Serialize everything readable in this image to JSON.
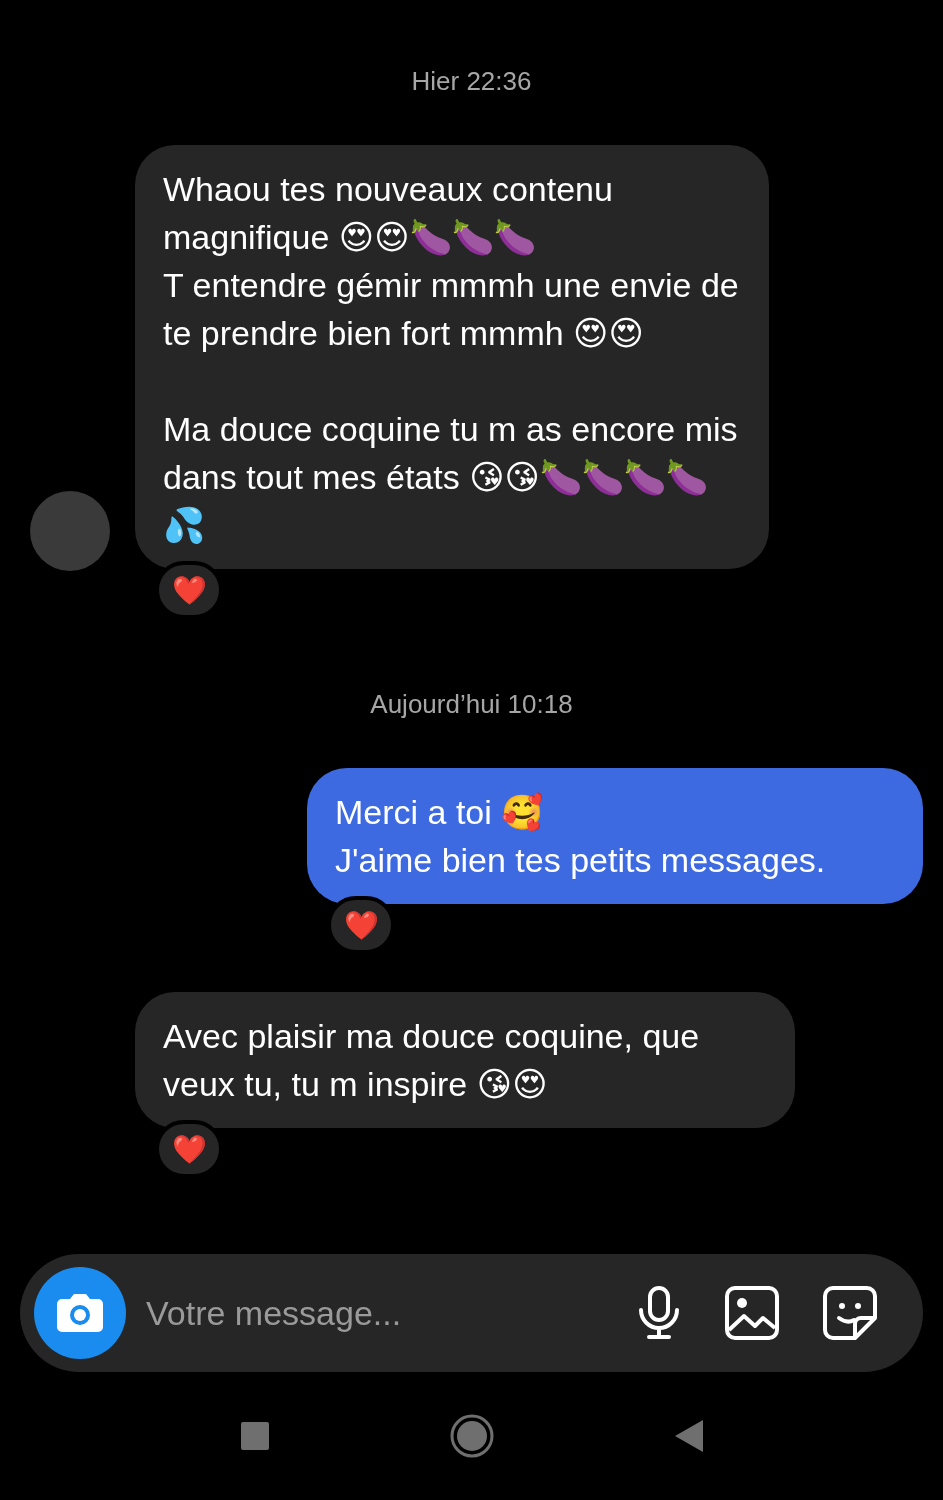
{
  "conversation": [
    {
      "kind": "timestamp",
      "text": "Hier 22:36"
    },
    {
      "kind": "incoming_message",
      "avatar": true,
      "text": "Whaou tes nouveaux contenu magnifique 😍😍🍆🍆🍆\nT entendre gémir mmmh une envie de te prendre bien fort mmmh 😍😍\n\nMa douce coquine tu m as encore mis dans tout mes états 😘😘🍆🍆🍆🍆💦",
      "reaction": "❤️"
    },
    {
      "kind": "timestamp",
      "text": "Aujourd’hui 10:18"
    },
    {
      "kind": "outgoing_message",
      "avatar": false,
      "text": "Merci a toi 🥰\nJ'aime bien tes petits messages.",
      "reaction": "❤️"
    },
    {
      "kind": "incoming_message",
      "avatar": false,
      "text": "Avec plaisir ma douce coquine, que veux tu, tu m inspire 😘😍",
      "reaction": "❤️"
    }
  ],
  "composer": {
    "placeholder": "Votre message..."
  }
}
